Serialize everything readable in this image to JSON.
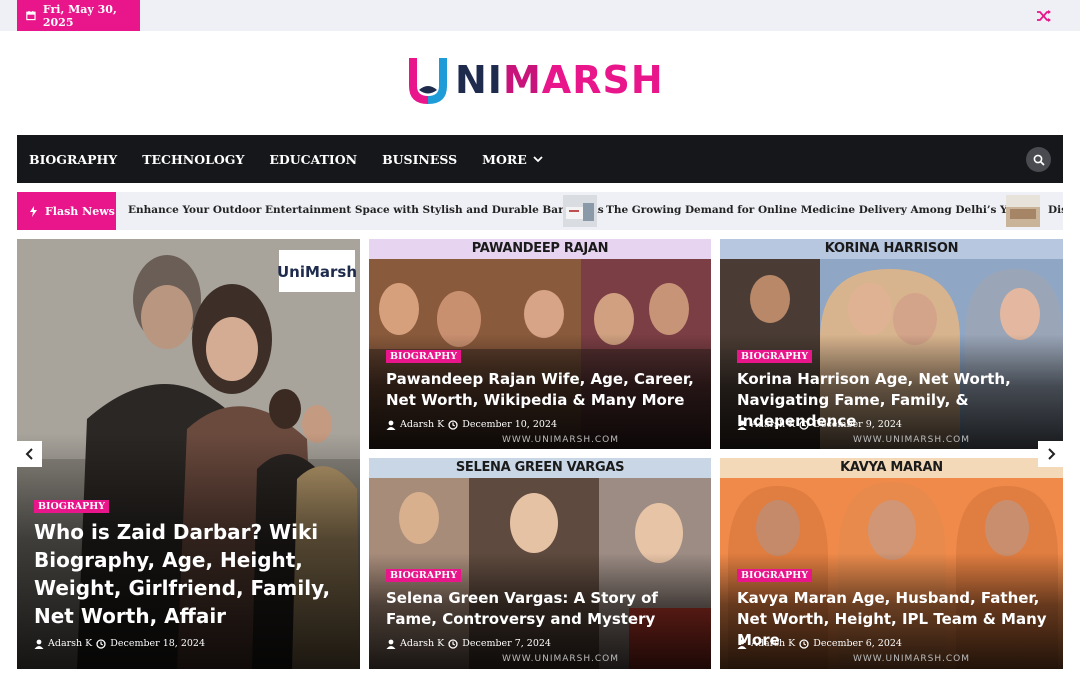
{
  "topbar": {
    "date": "Fri, May 30, 2025"
  },
  "logo": {
    "part1": "NI",
    "part2": "M",
    "part3": "ARSH"
  },
  "nav": {
    "items": [
      "BIOGRAPHY",
      "TECHNOLOGY",
      "EDUCATION",
      "BUSINESS"
    ],
    "more": "MORE"
  },
  "ticker": {
    "label": "Flash News",
    "items": [
      "Enhance Your Outdoor Entertainment Space with Stylish and Durable Bar Stools",
      "The Growing Demand for Online Medicine Delivery Among Delhi’s Youth",
      "Dis"
    ]
  },
  "hero": {
    "category": "BIOGRAPHY",
    "title": "Who is Zaid Darbar?  Wiki Biography, Age, Height, Weight, Girlfriend, Family, Net Worth, Affair",
    "author": "Adarsh K",
    "date": "December 18, 2024",
    "watermark": "UniMarsh"
  },
  "cards": [
    {
      "banner": "PAWANDEEP RAJAN",
      "category": "BIOGRAPHY",
      "title": "Pawandeep Rajan Wife, Age, Career, Net Worth, Wikipedia & Many More",
      "author": "Adarsh K",
      "date": "December 10, 2024",
      "watermark": "WWW.UNIMARSH.COM"
    },
    {
      "banner": "KORINA HARRISON",
      "category": "BIOGRAPHY",
      "title": "Korina Harrison Age, Net Worth, Navigating Fame, Family, & Independence",
      "author": "Adarsh K",
      "date": "December 9, 2024",
      "watermark": "WWW.UNIMARSH.COM"
    },
    {
      "banner": "SELENA GREEN VARGAS",
      "category": "BIOGRAPHY",
      "title": "Selena Green Vargas: A Story of Fame, Controversy and Mystery",
      "author": "Adarsh K",
      "date": "December 7, 2024",
      "watermark": "WWW.UNIMARSH.COM"
    },
    {
      "banner": "KAVYA MARAN",
      "category": "BIOGRAPHY",
      "title": "Kavya Maran Age, Husband, Father, Net Worth, Height, IPL Team & Many More",
      "author": "Adarsh K",
      "date": "December 6, 2024",
      "watermark": "WWW.UNIMARSH.COM"
    }
  ],
  "colors": {
    "accent": "#e8168a",
    "nav_bg": "#16171b",
    "logo_navy": "#1e2b4d"
  },
  "icons": [
    "calendar-icon",
    "shuffle-icon",
    "search-icon",
    "bolt-icon",
    "chevron-down-icon",
    "user-icon",
    "clock-icon",
    "chevron-left-icon",
    "chevron-right-icon"
  ]
}
